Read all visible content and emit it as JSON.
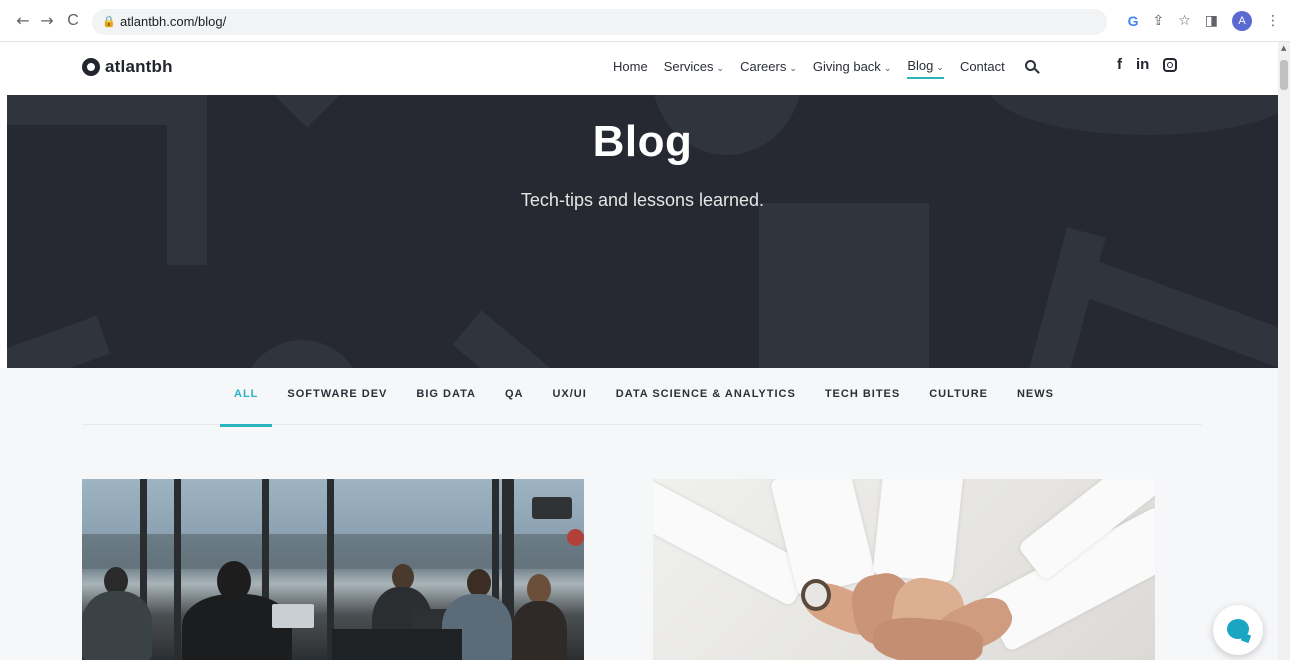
{
  "browser": {
    "back_icon": "←",
    "forward_icon": "→",
    "reload_icon": "C",
    "url": "atlantbh.com/blog/",
    "lock_icon": "🔒",
    "google_icon": "G",
    "share_icon": "⇪",
    "star_icon": "☆",
    "sidepanel_icon": "◨",
    "avatar_letter": "A",
    "menu_icon": "⋮"
  },
  "header": {
    "logo_text": "atlantbh",
    "nav": [
      {
        "label": "Home",
        "has_dropdown": false
      },
      {
        "label": "Services",
        "has_dropdown": true
      },
      {
        "label": "Careers",
        "has_dropdown": true
      },
      {
        "label": "Giving back",
        "has_dropdown": true
      },
      {
        "label": "Blog",
        "has_dropdown": true,
        "active": true
      },
      {
        "label": "Contact",
        "has_dropdown": false
      }
    ],
    "chevron": "⌄",
    "social": {
      "facebook": "f",
      "linkedin": "in",
      "instagram": "instagram-icon"
    }
  },
  "hero": {
    "title": "Blog",
    "subtitle": "Tech-tips and lessons learned."
  },
  "categories": [
    "ALL",
    "SOFTWARE DEV",
    "BIG DATA",
    "QA",
    "UX/UI",
    "DATA SCIENCE & ANALYTICS",
    "TECH BITES",
    "CULTURE",
    "NEWS"
  ],
  "active_category": "ALL",
  "colors": {
    "accent": "#2bb3c0",
    "hero_bg": "#262932",
    "text_dark": "#2b2f38",
    "chat": "#1aa6c2"
  }
}
